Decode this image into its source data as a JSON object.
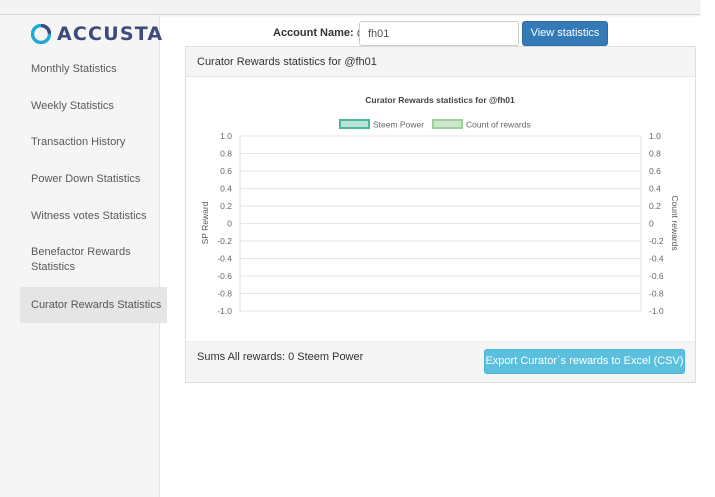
{
  "brand": {
    "logo_text": "ACCUSTA",
    "logo_color": "#3d4a7a",
    "logo_accent": "#1fa9d6"
  },
  "sidebar": {
    "items": [
      {
        "label": "Monthly Statistics",
        "active": false
      },
      {
        "label": "Weekly Statistics",
        "active": false
      },
      {
        "label": "Transaction History",
        "active": false
      },
      {
        "label": "Power Down Statistics",
        "active": false
      },
      {
        "label": "Witness votes Statistics",
        "active": false
      },
      {
        "label": "Benefactor Rewards Statistics",
        "active": false
      },
      {
        "label": "Curator Rewards Statistics",
        "active": true
      }
    ]
  },
  "form": {
    "account_label": "Account Name: @",
    "account_value": "fh01",
    "view_button": "View statistics"
  },
  "panel": {
    "heading": "Curator Rewards statistics for @fh01",
    "sums_text": "Sums All rewards: 0 Steem Power",
    "export_button": "Export Curator`s rewards to Excel (CSV)"
  },
  "colors": {
    "primary": "#337ab7",
    "info": "#5bc0de"
  },
  "chart_data": {
    "type": "line",
    "title": "Curator Rewards statistics for @fh01",
    "x": [],
    "series": [
      {
        "name": "Steem Power",
        "values": [],
        "fill": "#b8e3d8",
        "stroke": "#4bb89a"
      },
      {
        "name": "Count of rewards",
        "values": [],
        "fill": "#cfe6cf",
        "stroke": "#9ccf9c"
      }
    ],
    "ylabel": "SP Reward",
    "y2label": "Count rewards",
    "ylim": [
      -1.0,
      1.0
    ],
    "y2lim": [
      -1.0,
      1.0
    ],
    "yticks": [
      "1.0",
      "0.8",
      "0.6",
      "0.4",
      "0.2",
      "0",
      "-0.2",
      "-0.4",
      "-0.6",
      "-0.8",
      "-1.0"
    ],
    "y2ticks": [
      "1.0",
      "0.8",
      "0.6",
      "0.4",
      "0.2",
      "0",
      "-0.2",
      "-0.4",
      "-0.6",
      "-0.8",
      "-1.0"
    ],
    "grid": true,
    "legend": "top"
  }
}
